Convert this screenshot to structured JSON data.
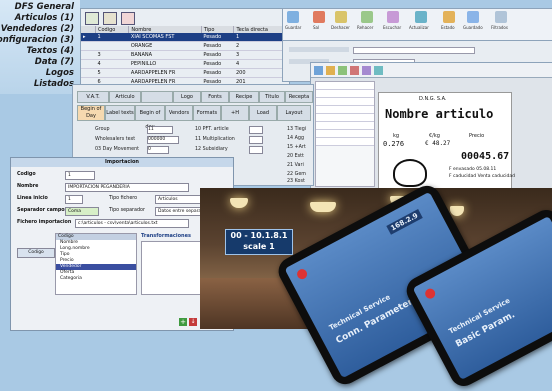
{
  "sidebar": {
    "items": [
      "DFS General",
      "Articulos (1)",
      "Vendedores (2)",
      "Configuracion (3)",
      "Textos (4)",
      "Data (7)",
      "Logos",
      "Listados"
    ]
  },
  "table_window": {
    "columns": [
      "Codigo",
      "Nombre",
      "Tipo",
      "Tecla directa"
    ],
    "rows": [
      {
        "codigo": "1",
        "nombre": "XIAI SCOMAS FST",
        "tipo": "Pesado",
        "tecla": "1",
        "selected": true
      },
      {
        "codigo": "",
        "nombre": "ORANGE",
        "tipo": "Pesado",
        "tecla": "2",
        "selected": false
      },
      {
        "codigo": "3",
        "nombre": "BANANA",
        "tipo": "Pesado",
        "tecla": "3",
        "selected": false
      },
      {
        "codigo": "4",
        "nombre": "PEPINILLO",
        "tipo": "Pesado",
        "tecla": "4",
        "selected": false
      },
      {
        "codigo": "5",
        "nombre": "AARDAPPELEN FR",
        "tipo": "Pesado",
        "tecla": "200",
        "selected": false
      },
      {
        "codigo": "6",
        "nombre": "AARDAPPELEN FR",
        "tipo": "Pesado",
        "tecla": "201",
        "selected": false
      }
    ]
  },
  "ribbon": {
    "labels": [
      "Guardar",
      "Sal",
      "Deshacer",
      "Rehacer",
      "Escuchar",
      "Actualizar",
      "Estado",
      "Guardado",
      "Filtrados"
    ]
  },
  "settings_window": {
    "tabs": [
      "V.A.T.",
      "Articulo",
      "",
      "Logo",
      "Fonts",
      "Recipe",
      "Titulo",
      "Recepta"
    ],
    "subtabs": [
      "Begin of Day",
      "Label texts",
      "Begin of day",
      "Vendors",
      "Formats",
      "+H",
      "Load",
      "Layout"
    ],
    "fields": [
      {
        "label": "Group",
        "value": "11"
      },
      {
        "label": "Wholesalers text",
        "value": "000000"
      },
      {
        "label": "03 Day Movement",
        "value": "0"
      }
    ],
    "right_fields": [
      "10 PFT. article",
      "11 Multiplication",
      "12 Subsidiary"
    ],
    "far_fields": [
      "13 Tiegi",
      "14 Agg",
      "15 +Art",
      "20 Estt",
      "21 Vari",
      "22 Gem",
      "23 Kost"
    ]
  },
  "label_preview": {
    "shop": "D.N.G. S.A.",
    "product": "Nombre articulo",
    "weight_label": "kg",
    "price_label": "€/kg",
    "total_label": "Precio",
    "weight": "0.276",
    "unit_price": "€ 48.27",
    "total": "00045.67",
    "date": "F envasado 05.08.11",
    "expiry": "F caducidad Venta caducidad"
  },
  "import_dialog": {
    "title": "Importacion",
    "fields": [
      {
        "label": "Codigo",
        "value": "1"
      },
      {
        "label": "Nombre",
        "value": "IMPORTACION PEGANDERIA"
      },
      {
        "label": "Linea inicio",
        "value": "1"
      },
      {
        "label": "Separador campos",
        "value": "Coma"
      },
      {
        "label": "Fichero importacion",
        "value": "c:\\articulos - csv\\venta\\articulos.txt"
      }
    ],
    "tipo_fichero_label": "Tipo fichero",
    "tipo_fichero_value": "Articulos",
    "tipo_separador_label": "Tipo separador",
    "tipo_separador_value": "Datos entre separadores",
    "list_items": [
      "Codigo",
      "Nombre",
      "Long.nombre",
      "Tipo",
      "Precio",
      "Vendedor",
      "Oferta",
      "Categoria"
    ],
    "transform_title": "Transformaciones",
    "list_btn": "Codigo"
  },
  "scale_badge": {
    "line1": "00 - 10.1.8.1",
    "line2": "scale 1"
  },
  "devices": [
    {
      "text1": "Technical Service",
      "text2": "Conn. Parameters",
      "badge": "168.2.9"
    },
    {
      "text1": "Technical Service",
      "text2": "Basic Param."
    }
  ],
  "colors": {
    "accent": "#1d3f85",
    "background": "#a9c9e4",
    "dialog": "#eef1f5"
  }
}
